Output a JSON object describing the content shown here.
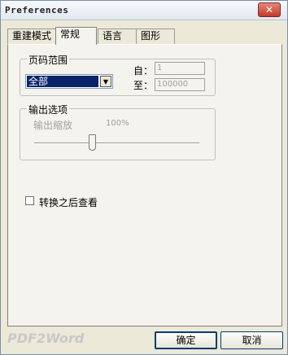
{
  "window": {
    "title": "Preferences",
    "close_glyph": "✕"
  },
  "tabs": [
    {
      "label": "重建模式"
    },
    {
      "label": "常规"
    },
    {
      "label": "语言"
    },
    {
      "label": "图形"
    }
  ],
  "page_range": {
    "group_label": "页码范围",
    "select_value": "全部",
    "from_label": "自：",
    "from_value": "1",
    "to_label": "至：",
    "to_value": "100000"
  },
  "output": {
    "group_label": "输出选项",
    "zoom_label": "输出缩放",
    "zoom_value": "100%"
  },
  "view_after": {
    "label": "转换之后查看",
    "checked": false
  },
  "footer": {
    "watermark": "PDF2Word",
    "ok_label": "确定",
    "cancel_label": "取消"
  },
  "icons": {
    "dropdown": "▼"
  }
}
